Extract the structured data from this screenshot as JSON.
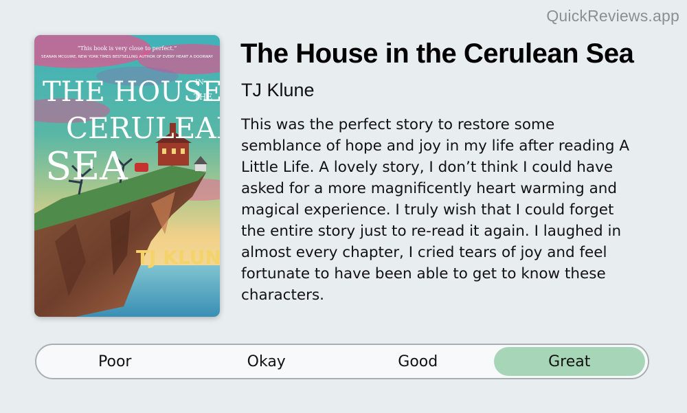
{
  "brand": "QuickReviews.app",
  "book": {
    "title": "The House in the Cerulean Sea",
    "author": "TJ Klune",
    "cover": {
      "quote_line1": "“This book is very close to perfect.”",
      "quote_line2": "SEANAN MCGUIRE, NEW YORK TIMES BESTSELLING AUTHOR OF EVERY HEART A DOORWAY",
      "title_line1": "THE HOUSE",
      "title_in": "IN",
      "title_the": "THE",
      "title_line2": "CERULEAN",
      "title_line3": "SEA",
      "author": "TJ KLUNE"
    }
  },
  "review": "This was the perfect story to restore some semblance of hope and joy in my life after reading A Little Life. A lovely story, I don’t think I could have asked for a more magnificently heart warming and magical experience. I truly wish that I could forget the entire story just to re-read it again. I laughed in almost every chapter, I cried tears of joy and feel fortunate to have been able to get to know these characters.",
  "rating": {
    "options": [
      "Poor",
      "Okay",
      "Good",
      "Great"
    ],
    "selected": "Great",
    "selected_color": "#a6d6b7"
  },
  "colors": {
    "background": "#e8edf0",
    "brand_text": "#8a8f93",
    "selector_border": "#a9aeb1"
  }
}
